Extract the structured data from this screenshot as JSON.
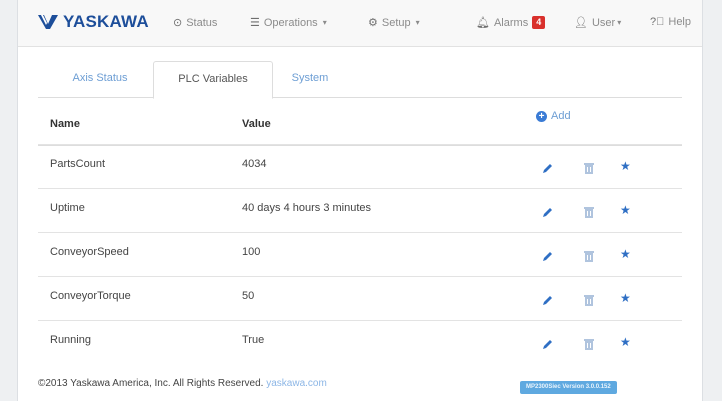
{
  "brand": {
    "name": "YASKAWA",
    "color": "#1d4e9a"
  },
  "nav": {
    "status": "Status",
    "operations": "Operations",
    "setup": "Setup",
    "alarms": "Alarms",
    "alarm_count": "4",
    "user": "User",
    "help": "Help"
  },
  "tabs": [
    {
      "label": "Axis Status",
      "active": false
    },
    {
      "label": "PLC Variables",
      "active": true
    },
    {
      "label": "System",
      "active": false
    }
  ],
  "table": {
    "columns": [
      "Name",
      "Value"
    ],
    "add_label": "Add",
    "rows": [
      {
        "name": "PartsCount",
        "value": "4034"
      },
      {
        "name": "Uptime",
        "value": "40 days 4 hours 3 minutes"
      },
      {
        "name": "ConveyorSpeed",
        "value": "100"
      },
      {
        "name": "ConveyorTorque",
        "value": "50"
      },
      {
        "name": "Running",
        "value": "True"
      }
    ],
    "row_actions": [
      "pencil-icon",
      "trash-icon",
      "star-icon"
    ]
  },
  "footer": {
    "copyright": "©2013 Yaskawa America, Inc. All Rights Reserved.",
    "link": "yaskawa.com",
    "version": "MP2300Siec Version 3.0.0.152"
  },
  "colors": {
    "accent": "#3a7bd5",
    "link": "#6d9ed4",
    "alarm_badge": "#d9302c",
    "version_badge": "#5fa9e0"
  }
}
